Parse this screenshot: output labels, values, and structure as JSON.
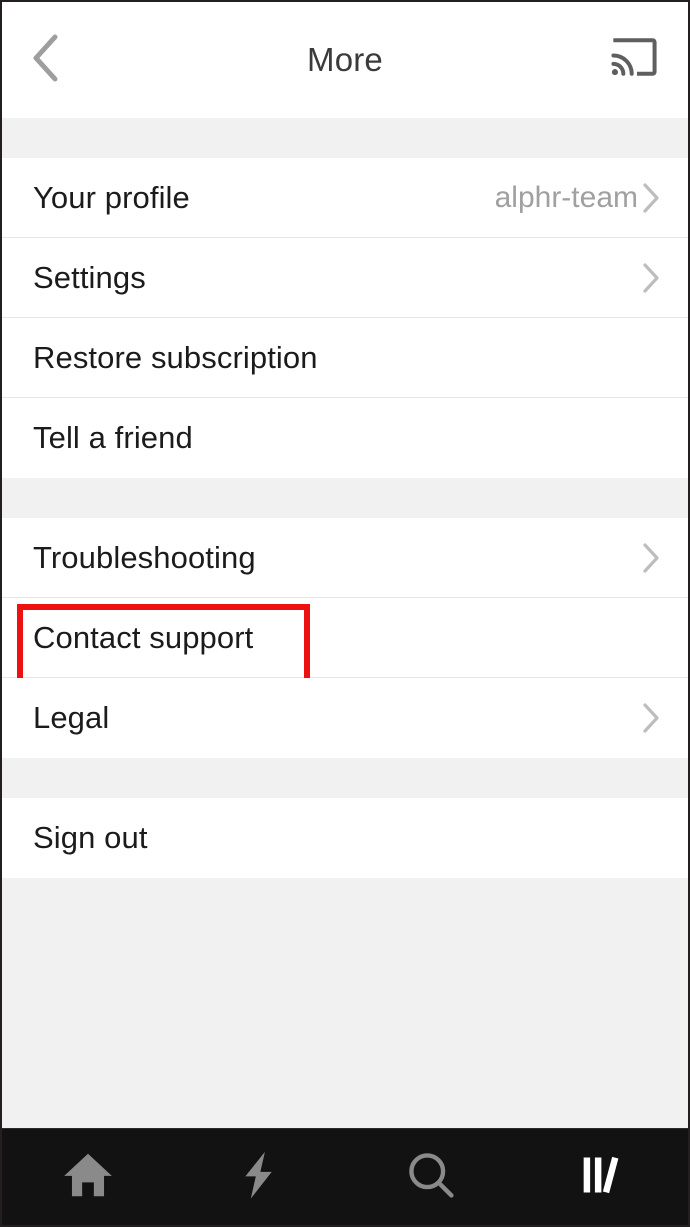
{
  "app": {
    "screen_name": "More"
  },
  "colors": {
    "annotation": "#ee1111",
    "page_background": "#f1f1f1",
    "row_background": "#ffffff",
    "nav_background": "#121212",
    "label_text": "#1b1b1b",
    "value_text": "#a0a0a0",
    "chevron": "#bdbdbd",
    "nav_icon_inactive": "#8a8a8a",
    "nav_icon_active": "#ffffff"
  },
  "header": {
    "title": "More",
    "back_icon": "chevron-left-icon",
    "cast_icon": "cast-icon"
  },
  "groups": [
    {
      "id": "account",
      "rows": [
        {
          "label": "Your profile",
          "value": "alphr-team",
          "chevron": true,
          "annotated": false
        },
        {
          "label": "Settings",
          "value": "",
          "chevron": true,
          "annotated": false
        },
        {
          "label": "Restore subscription",
          "value": "",
          "chevron": false,
          "annotated": false
        },
        {
          "label": "Tell a friend",
          "value": "",
          "chevron": false,
          "annotated": false
        }
      ]
    },
    {
      "id": "support",
      "rows": [
        {
          "label": "Troubleshooting",
          "value": "",
          "chevron": true,
          "annotated": false
        },
        {
          "label": "Contact support",
          "value": "",
          "chevron": false,
          "annotated": true
        },
        {
          "label": "Legal",
          "value": "",
          "chevron": true,
          "annotated": false
        }
      ]
    },
    {
      "id": "session",
      "rows": [
        {
          "label": "Sign out",
          "value": "",
          "chevron": false,
          "annotated": false
        }
      ]
    }
  ],
  "bottom_nav": {
    "items": [
      {
        "id": "home",
        "icon": "home-icon",
        "active": false
      },
      {
        "id": "flash",
        "icon": "lightning-bolt-icon",
        "active": false
      },
      {
        "id": "search",
        "icon": "search-icon",
        "active": false
      },
      {
        "id": "library",
        "icon": "library-books-icon",
        "active": true
      }
    ]
  }
}
